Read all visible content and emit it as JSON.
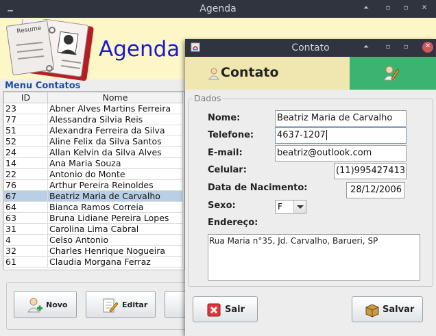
{
  "main_window": {
    "title": "Agenda",
    "heading": "Agenda",
    "logo_text": "Resume",
    "menu_label": "Menu Contatos",
    "table": {
      "columns": [
        "ID",
        "Nome"
      ],
      "rows": [
        {
          "id": "23",
          "nome": "Abner Alves Martins Ferreira"
        },
        {
          "id": "77",
          "nome": "Alessandra Silvia Reis"
        },
        {
          "id": "51",
          "nome": "Alexandra Ferreira da Silva"
        },
        {
          "id": "52",
          "nome": "Aline Felix da Silva Santos"
        },
        {
          "id": "24",
          "nome": "Allan Kelvin da Silva Alves"
        },
        {
          "id": "14",
          "nome": "Ana Maria Souza"
        },
        {
          "id": "22",
          "nome": "Antonio do Monte"
        },
        {
          "id": "76",
          "nome": "Arthur Pereira Reinoldes"
        },
        {
          "id": "67",
          "nome": "Beatriz Maria de Carvalho"
        },
        {
          "id": "64",
          "nome": "Bianca Ramos Correia"
        },
        {
          "id": "63",
          "nome": "Bruna Lidiane Pereira Lopes"
        },
        {
          "id": "31",
          "nome": "Carolina Lima Cabral"
        },
        {
          "id": "4",
          "nome": "Celso Antonio"
        },
        {
          "id": "32",
          "nome": "Charles Henrique Nogueira"
        },
        {
          "id": "61",
          "nome": "Claudia Morgana Ferraz"
        }
      ],
      "selected_index": 8
    },
    "buttons": {
      "novo": "Novo",
      "editar": "Editar"
    }
  },
  "dialog": {
    "title": "Contato",
    "heading": "Contato",
    "group_title": "Dados",
    "labels": {
      "nome": "Nome:",
      "telefone": "Telefone:",
      "email": "E-mail:",
      "celular": "Celular:",
      "nascimento": "Data de Nacimento:",
      "sexo": "Sexo:",
      "endereco": "Endereço:"
    },
    "values": {
      "nome": "Beatriz Maria de Carvalho",
      "telefone": "4637-1207",
      "email": "beatriz@outlook.com",
      "celular": "(11)995427413",
      "nascimento": "28/12/2006",
      "sexo": "F",
      "endereco": "Rua Maria n°35, Jd. Carvalho, Barueri, SP"
    },
    "buttons": {
      "sair": "Sair",
      "salvar": "Salvar"
    }
  },
  "colors": {
    "titlebar": "#2f343f",
    "header_bg": "#fdf6c7",
    "heading_blue": "#1a1ad6",
    "menu_label": "#1f4ea8",
    "selected_row": "#b8cfe5",
    "dialog_header_left": "#f0e7b0",
    "dialog_header_right": "#3cb371",
    "sair_icon": "#e0373a"
  },
  "icons": [
    "minimize-icon",
    "maximize-icon",
    "restore-icon",
    "close-icon",
    "java-app-icon",
    "book-logo-icon",
    "user-icon",
    "user-edit-icon",
    "add-user-icon",
    "edit-icon",
    "exit-icon",
    "save-icon",
    "dropdown-arrow-icon"
  ]
}
